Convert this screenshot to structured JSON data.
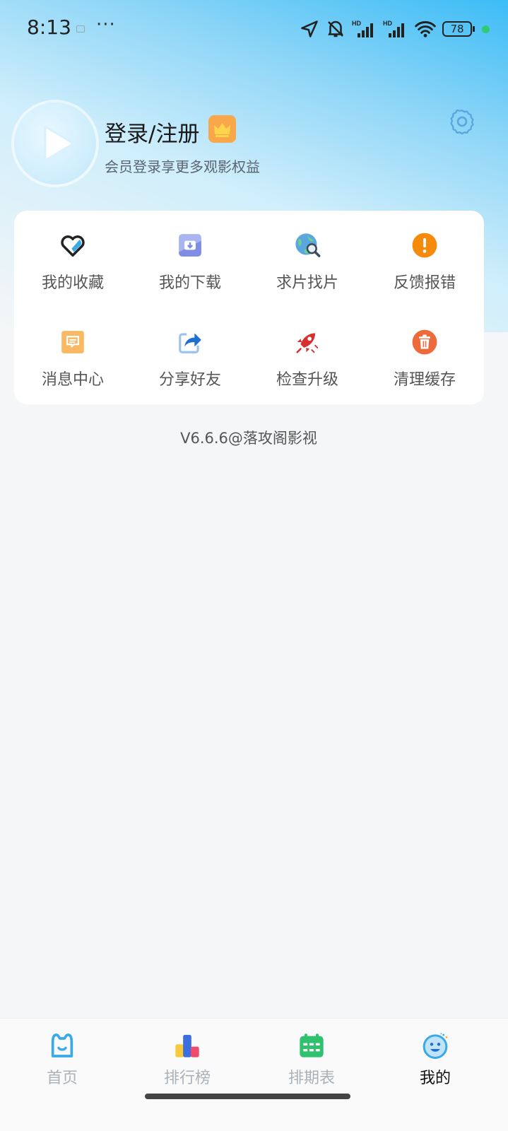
{
  "status_bar": {
    "time": "8:13",
    "more": "···",
    "battery": "78",
    "icons": [
      "location-icon",
      "mute-icon",
      "signal-hd-icon",
      "signal-hd-icon",
      "wifi-icon",
      "battery-icon"
    ]
  },
  "profile": {
    "title": "登录/注册",
    "subtitle": "会员登录享更多观影权益",
    "avatar_icon": "play-logo-icon",
    "badge_icon": "crown-icon",
    "settings_icon": "gear-icon"
  },
  "menu": {
    "items": [
      {
        "label": "我的收藏",
        "icon": "heart-icon"
      },
      {
        "label": "我的下载",
        "icon": "download-icon"
      },
      {
        "label": "求片找片",
        "icon": "globe-search-icon"
      },
      {
        "label": "反馈报错",
        "icon": "alert-icon"
      },
      {
        "label": "消息中心",
        "icon": "message-icon"
      },
      {
        "label": "分享好友",
        "icon": "share-icon"
      },
      {
        "label": "检查升级",
        "icon": "rocket-icon"
      },
      {
        "label": "清理缓存",
        "icon": "trash-icon"
      }
    ]
  },
  "version": "V6.6.6@落攻阁影视",
  "bottom_nav": {
    "items": [
      {
        "label": "首页",
        "icon": "home-icon"
      },
      {
        "label": "排行榜",
        "icon": "ranking-icon"
      },
      {
        "label": "排期表",
        "icon": "calendar-icon"
      },
      {
        "label": "我的",
        "icon": "smile-icon"
      }
    ],
    "active": "我的"
  },
  "colors": {
    "accent_blue": "#3cbcf6",
    "alert_orange": "#f58a0b",
    "trash_orange": "#ef6a3a",
    "calendar_green": "#2fc16e",
    "crown_badge": "#f8a84a"
  }
}
